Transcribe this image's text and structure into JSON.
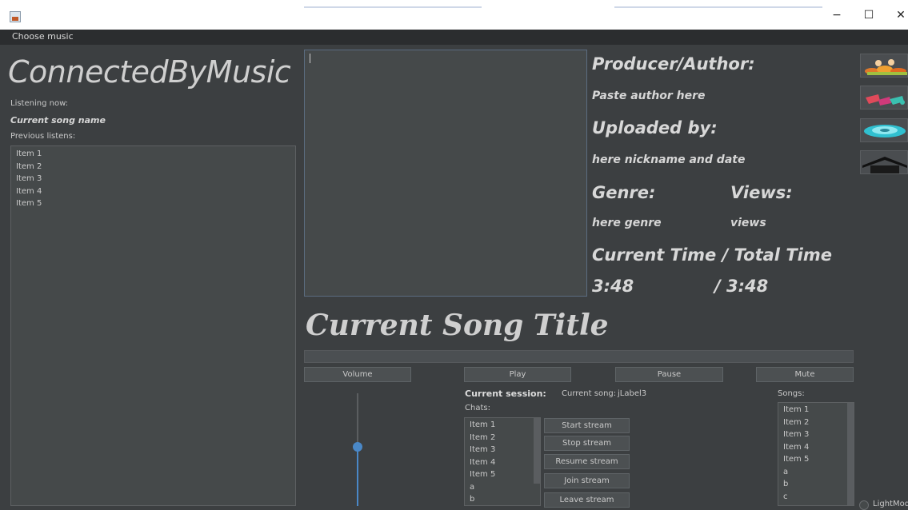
{
  "window": {
    "minimize": "−",
    "maximize": "☐",
    "close": "✕"
  },
  "menu": {
    "choose_music": "Choose music"
  },
  "app": {
    "logo": "ConnectedByMusic"
  },
  "left": {
    "listening_now_label": "Listening now:",
    "current_song_name": "Current song name",
    "previous_listens_label": "Previous listens:",
    "previous_listens": [
      "Item 1",
      "Item 2",
      "Item 3",
      "Item 4",
      "Item 5"
    ]
  },
  "info": {
    "producer_label": "Producer/Author:",
    "producer_value": "Paste author here",
    "uploaded_label": "Uploaded by:",
    "uploaded_value": "here nickname and date",
    "genre_label": "Genre:",
    "genre_value": "here genre",
    "views_label": "Views:",
    "views_value": "views",
    "time_label": "Current Time / Total Time",
    "current_time": "3:48",
    "total_time": "/ 3:48"
  },
  "song": {
    "title": "Current Song Title"
  },
  "controls": {
    "volume": "Volume",
    "play": "Play",
    "pause": "Pause",
    "mute": "Mute"
  },
  "session": {
    "label": "Current session:",
    "current_song_label": "Current song:",
    "current_song_value": "jLabel3",
    "chats_label": "Chats:",
    "chats": [
      "Item 1",
      "Item 2",
      "Item 3",
      "Item 4",
      "Item 5",
      "a",
      "b"
    ],
    "buttons": {
      "start": "Start stream",
      "stop": "Stop stream",
      "resume": "Resume stream",
      "join": "Join stream",
      "leave": "Leave stream"
    },
    "songs_label": "Songs:",
    "songs": [
      "Item 1",
      "Item 2",
      "Item 3",
      "Item 4",
      "Item 5",
      "a",
      "b",
      "c"
    ]
  },
  "lightmode": {
    "label": "LightMode"
  },
  "colors": {
    "background": "#3c3f41",
    "accent": "#4a88c7"
  },
  "volume_level": 0.5
}
